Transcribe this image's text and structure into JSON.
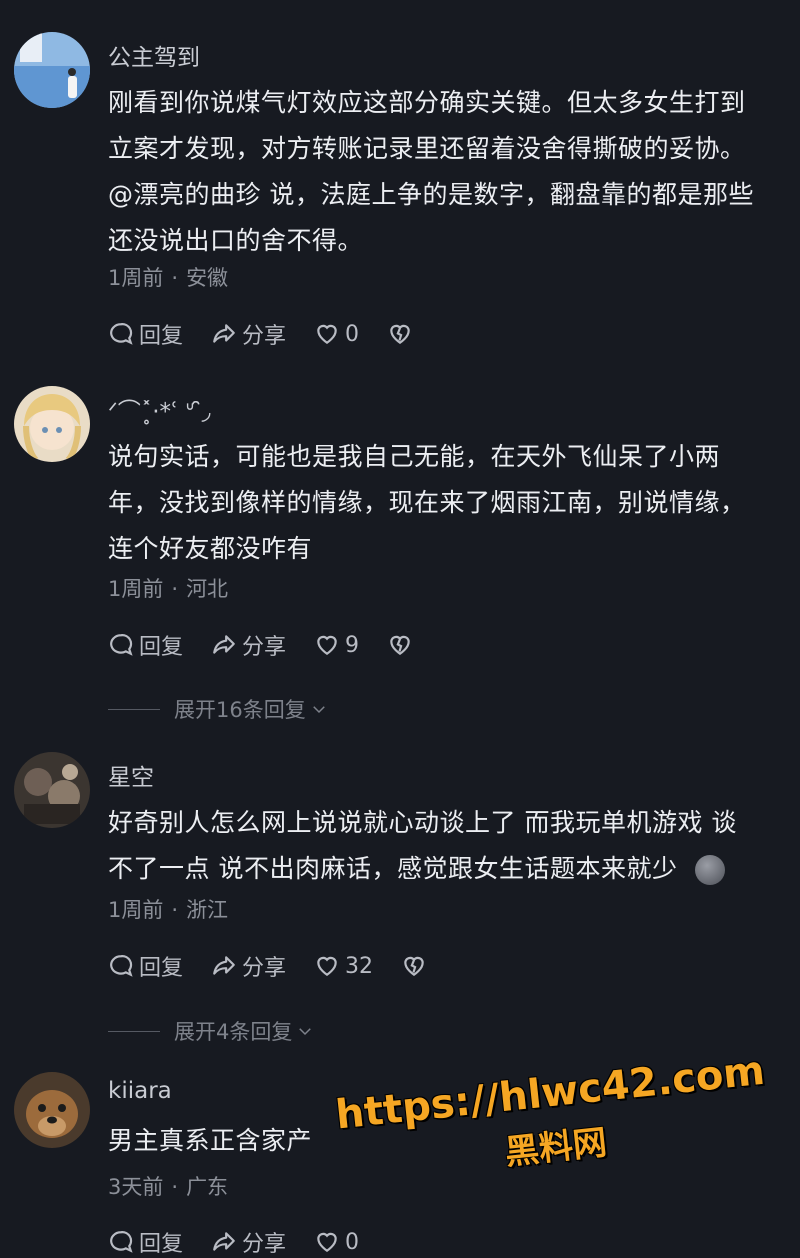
{
  "actions": {
    "reply": "回复",
    "share": "分享"
  },
  "comments": [
    {
      "username": "公主驾到",
      "avatar": "woman-by-sea-avatar",
      "lines": [
        "刚看到你说煤气灯效应这部分确实关键。但太多女生打到",
        "立案才发现，对方转账记录里还留着没舍得撕破的妥协。",
        "@漂亮的曲珍 说，法庭上争的是数字，翻盘靠的都是那些",
        "还没说出口的舍不得。"
      ],
      "time": "1周前",
      "location": "安徽",
      "likes": "0"
    },
    {
      "username": "ᐟ⌒˟̥·*ʿ ᐡ ̑̑◞",
      "avatar": "anime-girl-avatar",
      "lines": [
        "说句实话，可能也是我自己无能，在天外飞仙呆了小两",
        "年，没找到像样的情缘，现在来了烟雨江南，别说情缘，",
        "连个好友都没咋有"
      ],
      "time": "1周前",
      "location": "河北",
      "likes": "9",
      "expand": "展开16条回复"
    },
    {
      "username": "星空",
      "avatar": "dark-photo-avatar",
      "lines": [
        "好奇别人怎么网上说说就心动谈上了  而我玩单机游戏  谈",
        "不了一点  说不出肉麻话，感觉跟女生话题本来就少"
      ],
      "time": "1周前",
      "location": "浙江",
      "likes": "32",
      "expand": "展开4条回复"
    },
    {
      "username": "kiiara",
      "avatar": "dog-avatar",
      "lines": [
        "男主真系正含家产"
      ],
      "time": "3天前",
      "location": "广东",
      "likes": "0"
    }
  ],
  "watermark": {
    "url": "https://hlwc42.com",
    "site": "黑料网"
  }
}
